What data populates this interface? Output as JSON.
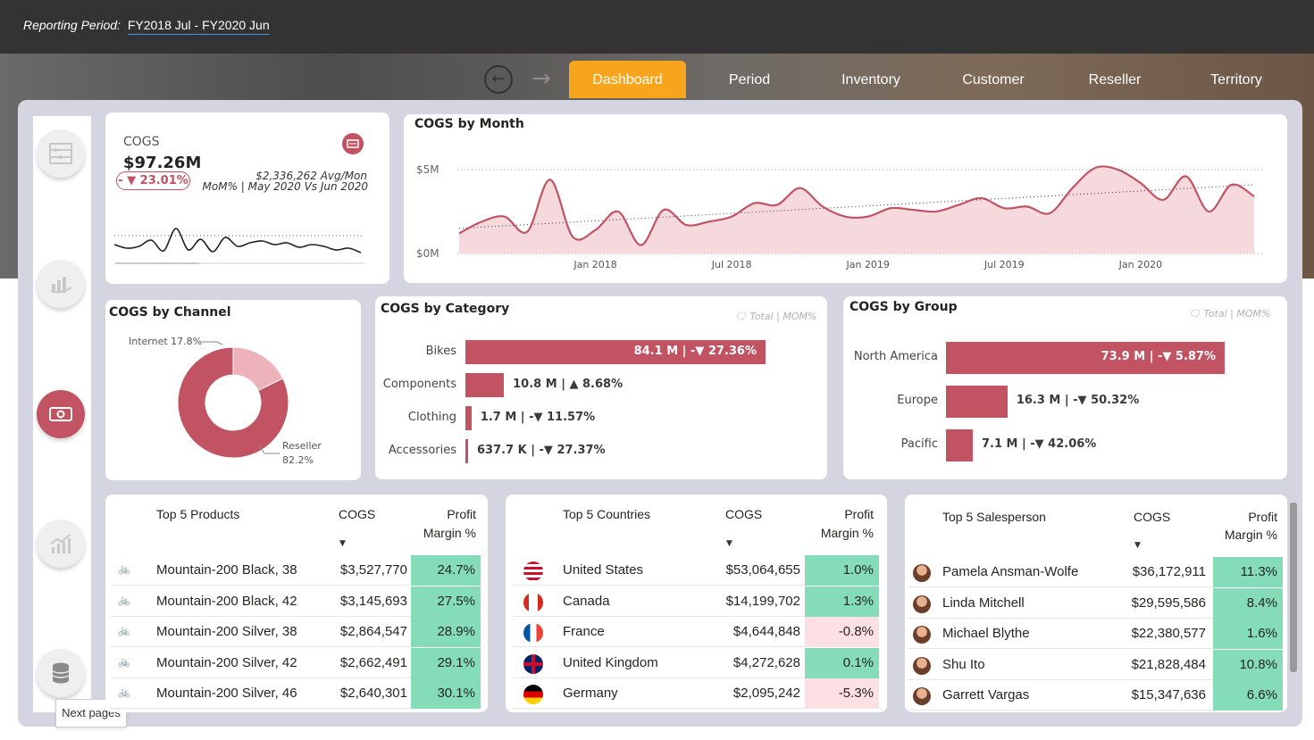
{
  "header": {
    "period_label": "Reporting Period:",
    "period_value": "FY2018  Jul - FY2020  Jun"
  },
  "tabs": [
    {
      "label": "Dashboard",
      "active": true
    },
    {
      "label": "Period"
    },
    {
      "label": "Inventory"
    },
    {
      "label": "Customer"
    },
    {
      "label": "Reseller"
    },
    {
      "label": "Territory"
    }
  ],
  "nav_icons": [
    "abacus-icon",
    "money-hand-icon",
    "cash-icon",
    "growth-chart-icon",
    "database-icon"
  ],
  "tooltip": "Next pages",
  "kpi": {
    "label": "COGS",
    "value": "$97.26M",
    "change": "- ▼ 23.01%",
    "avg": "$2,336,262 Avg/Mon",
    "mom": "MoM% | May 2020 Vs Jun 2020",
    "spark": [
      38,
      42,
      40,
      33,
      45,
      20,
      44,
      32,
      46,
      30,
      40,
      36,
      34,
      38,
      36,
      41,
      38,
      40,
      44,
      42,
      47
    ]
  },
  "chart_data": [
    {
      "type": "area",
      "title": "COGS by Month",
      "y_ticks": [
        "$5M",
        "$0M"
      ],
      "x_ticks": [
        "Jan 2018",
        "Jul 2018",
        "Jan 2019",
        "Jul 2019",
        "Jan 2020"
      ],
      "x": [
        "2017-07",
        "2017-08",
        "2017-09",
        "2017-10",
        "2017-11",
        "2017-12",
        "2018-01",
        "2018-02",
        "2018-03",
        "2018-04",
        "2018-05",
        "2018-06",
        "2018-07",
        "2018-08",
        "2018-09",
        "2018-10",
        "2018-11",
        "2018-12",
        "2019-01",
        "2019-02",
        "2019-03",
        "2019-04",
        "2019-05",
        "2019-06",
        "2019-07",
        "2019-08",
        "2019-09",
        "2019-10",
        "2019-11",
        "2019-12",
        "2020-01",
        "2020-02",
        "2020-03",
        "2020-04",
        "2020-05",
        "2020-06"
      ],
      "values": [
        1.2,
        1.9,
        2.2,
        1.3,
        4.4,
        1.0,
        1.4,
        2.5,
        0.5,
        2.6,
        1.7,
        1.9,
        2.2,
        3.0,
        2.9,
        3.9,
        2.8,
        2.2,
        2.2,
        2.7,
        2.6,
        2.5,
        2.9,
        3.3,
        2.7,
        2.8,
        2.4,
        3.9,
        5.1,
        5.0,
        4.2,
        3.2,
        4.6,
        2.5,
        4.1,
        3.4
      ],
      "ylim": [
        0,
        5
      ],
      "trend": [
        1.5,
        4.1
      ]
    },
    {
      "type": "pie",
      "title": "COGS by Channel",
      "labels": [
        "Internet",
        "Reseller"
      ],
      "values": [
        17.8,
        82.2
      ],
      "slice_labels": [
        "Internet 17.8%",
        "Reseller",
        "82.2%"
      ],
      "colors": [
        "#edb2ba",
        "#c15363"
      ]
    },
    {
      "type": "bar",
      "title": "COGS by Category",
      "legend_note": "Total | MOM%",
      "categories": [
        "Bikes",
        "Components",
        "Clothing",
        "Accessories"
      ],
      "values": [
        84.1,
        10.8,
        1.7,
        0.6377
      ],
      "labels": [
        "84.1 M | -▼ 27.36%",
        "10.8 M | ▲ 8.68%",
        "1.7 M | -▼ 11.57%",
        "637.7 K | -▼ 27.37%"
      ]
    },
    {
      "type": "bar",
      "title": "COGS by Group",
      "legend_note": "Total | MOM%",
      "categories": [
        "North America",
        "Europe",
        "Pacific"
      ],
      "values": [
        73.9,
        16.3,
        7.1
      ],
      "labels": [
        "73.9 M | -▼ 5.87%",
        "16.3 M | -▼ 50.32%",
        "7.1 M | -▼ 42.06%"
      ]
    }
  ],
  "products": {
    "headers": [
      "Top 5 Products",
      "COGS",
      "Profit",
      "Margin %"
    ],
    "rows": [
      {
        "name": "Mountain-200 Black, 38",
        "cogs": "$3,527,770",
        "pm": "24.7%",
        "pos": true
      },
      {
        "name": "Mountain-200 Black, 42",
        "cogs": "$3,145,693",
        "pm": "27.5%",
        "pos": true
      },
      {
        "name": "Mountain-200 Silver, 38",
        "cogs": "$2,864,547",
        "pm": "28.9%",
        "pos": true
      },
      {
        "name": "Mountain-200 Silver, 42",
        "cogs": "$2,662,491",
        "pm": "29.1%",
        "pos": true
      },
      {
        "name": "Mountain-200 Silver, 46",
        "cogs": "$2,640,301",
        "pm": "30.1%",
        "pos": true
      }
    ]
  },
  "countries": {
    "headers": [
      "Top 5 Countries",
      "COGS",
      "Profit",
      "Margin %"
    ],
    "rows": [
      {
        "name": "United States",
        "cogs": "$53,064,655",
        "pm": "1.0%",
        "pos": true,
        "flag": "us-flag-icon"
      },
      {
        "name": "Canada",
        "cogs": "$14,199,702",
        "pm": "1.3%",
        "pos": true,
        "flag": "canada-flag-icon"
      },
      {
        "name": "France",
        "cogs": "$4,644,848",
        "pm": "-0.8%",
        "pos": false,
        "flag": "france-flag-icon"
      },
      {
        "name": "United Kingdom",
        "cogs": "$4,272,628",
        "pm": "0.1%",
        "pos": true,
        "flag": "uk-flag-icon"
      },
      {
        "name": "Germany",
        "cogs": "$2,095,242",
        "pm": "-5.3%",
        "pos": false,
        "flag": "germany-flag-icon"
      }
    ]
  },
  "salespeople": {
    "headers": [
      "Top 5 Salesperson",
      "COGS",
      "Profit",
      "Margin %"
    ],
    "rows": [
      {
        "name": "Pamela Ansman-Wolfe",
        "cogs": "$36,172,911",
        "pm": "11.3%",
        "pos": true
      },
      {
        "name": "Linda Mitchell",
        "cogs": "$29,595,586",
        "pm": "8.4%",
        "pos": true
      },
      {
        "name": "Michael Blythe",
        "cogs": "$22,380,577",
        "pm": "1.6%",
        "pos": true
      },
      {
        "name": "Shu Ito",
        "cogs": "$21,828,484",
        "pm": "10.8%",
        "pos": true
      },
      {
        "name": "Garrett Vargas",
        "cogs": "$15,347,636",
        "pm": "6.6%",
        "pos": true
      }
    ]
  }
}
